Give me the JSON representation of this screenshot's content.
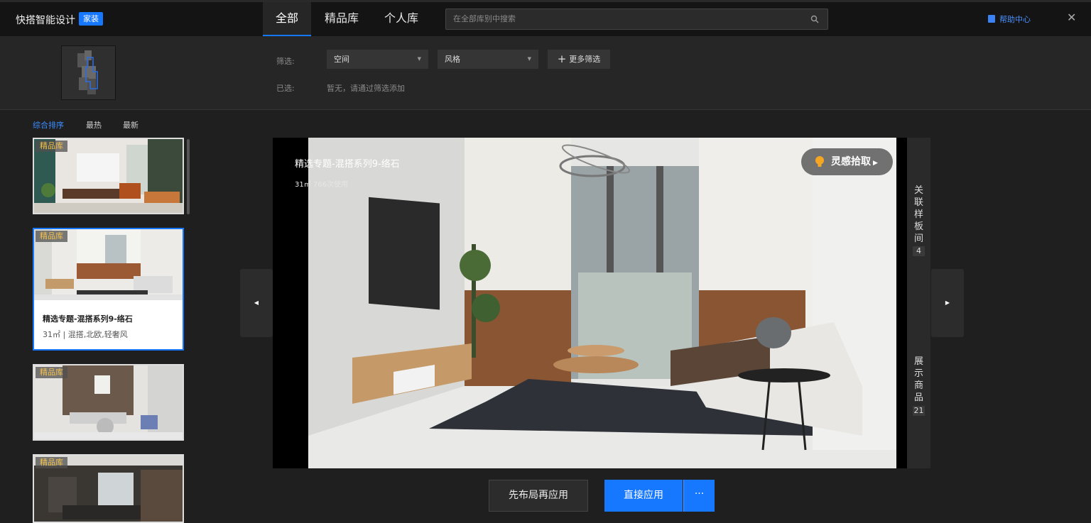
{
  "app": {
    "brand": "快搭智能设计",
    "brand_tag": "家装",
    "help_label": "帮助中心",
    "close_glyph": "✕"
  },
  "tabs": [
    {
      "label": "全部",
      "active": true
    },
    {
      "label": "精品库",
      "active": false
    },
    {
      "label": "个人库",
      "active": false
    }
  ],
  "search": {
    "placeholder": "在全部库别中搜索"
  },
  "filters": {
    "filter_label": "筛选:",
    "space_select": "空间",
    "style_select": "风格",
    "more_label": "更多筛选",
    "selected_label": "已选:",
    "selected_empty": "暂无，请通过筛选添加"
  },
  "sort": [
    "综合排序",
    "最热",
    "最新"
  ],
  "cards": [
    {
      "badge": "精品库"
    },
    {
      "badge": "精品库",
      "title": "精选专题-混搭系列9-络石",
      "sub": "31㎡ | 混搭,北欧,轻奢风"
    },
    {
      "badge": "精品库"
    },
    {
      "badge": "精品库"
    }
  ],
  "preview": {
    "title": "精选专题-混搭系列9-络石",
    "meta": "31㎡   766次使用",
    "inspire_label": "灵感拾取"
  },
  "side": {
    "related_label": "关联样板间",
    "related_count": "4",
    "products_label": "展示商品",
    "products_count": "21"
  },
  "actions": {
    "layout_first": "先布局再应用",
    "apply_direct": "直接应用",
    "more": "···"
  },
  "colors": {
    "accent": "#1677ff",
    "badge_text": "#f4c04a",
    "bg": "#1f1f1f"
  }
}
